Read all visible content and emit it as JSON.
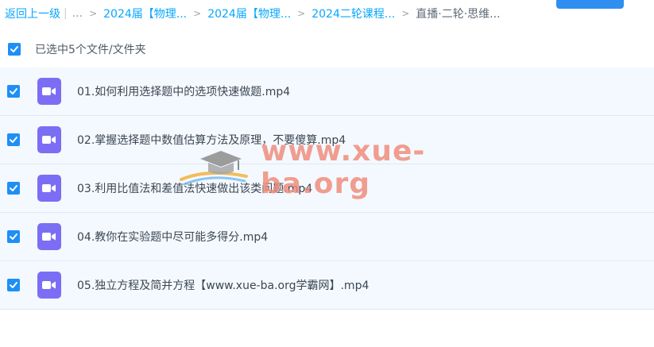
{
  "breadcrumb": {
    "back_label": "返回上一级",
    "pipe": "|",
    "dots": "...",
    "separator": ">",
    "items": [
      "2024届【物理...",
      "2024届【物理...",
      "2024二轮课程..."
    ],
    "current": "直播·二轮·思维..."
  },
  "selection": {
    "label": "已选中5个文件/文件夹",
    "checked": true
  },
  "files": [
    {
      "name": "01.如何利用选择题中的选项快速做题.mp4",
      "checked": true,
      "icon": "video-file-icon"
    },
    {
      "name": "02.掌握选择题中数值估算方法及原理，不要傻算.mp4",
      "checked": true,
      "icon": "video-file-icon"
    },
    {
      "name": "03.利用比值法和差值法快速做出该类问题.mp4",
      "checked": true,
      "icon": "video-file-icon"
    },
    {
      "name": "04.教你在实验题中尽可能多得分.mp4",
      "checked": true,
      "icon": "video-file-icon"
    },
    {
      "name": "05.独立方程及简并方程【www.xue-ba.org学霸网】.mp4",
      "checked": true,
      "icon": "video-file-icon"
    }
  ],
  "watermark": {
    "text": "www.xue-ba.org",
    "icon": "graduation-cap-icon"
  },
  "colors": {
    "accent": "#06a7ff",
    "checkbox": "#1e8ff6",
    "row_bg": "#f4f9ff",
    "file_icon": "#7b6ef5",
    "watermark": "#f08a78"
  }
}
